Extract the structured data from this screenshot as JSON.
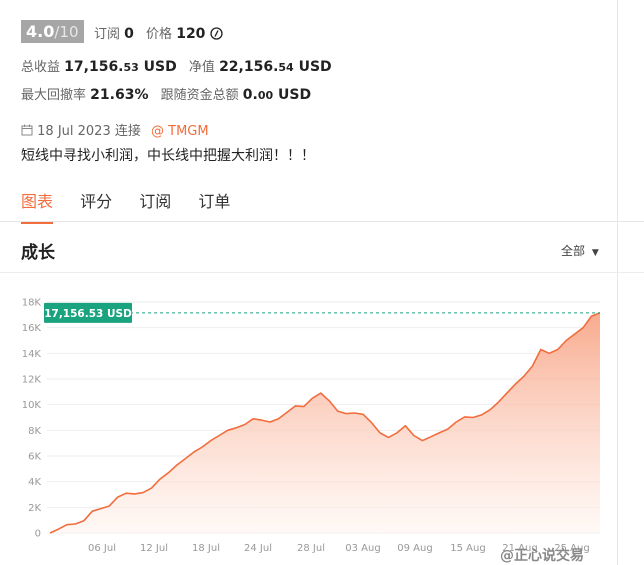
{
  "header": {
    "rating": "4.0",
    "rating_max": "/10",
    "subscribe_label": "订阅",
    "subscribe_count": "0",
    "price_label": "价格",
    "price_value": "120",
    "price_icon": "currency-coin-icon"
  },
  "stats": {
    "total_profit_label": "总收益",
    "total_profit_main": "17,156.",
    "total_profit_dec": "53",
    "total_profit_unit": " USD",
    "net_label": "净值",
    "net_main": "22,156.",
    "net_dec": "54",
    "net_unit": " USD",
    "drawdown_label": "最大回撤率",
    "drawdown_value": "21.63%",
    "follow_label": "跟随资金总额",
    "follow_main": "0.",
    "follow_dec": "00",
    "follow_unit": " USD"
  },
  "meta": {
    "date": "18 Jul 2023 连接",
    "broker": "@ TMGM",
    "description": "短线中寻找小利润，中长线中把握大利润！！！"
  },
  "tabs": [
    {
      "label": "图表",
      "active": true
    },
    {
      "label": "评分",
      "active": false
    },
    {
      "label": "订阅",
      "active": false
    },
    {
      "label": "订单",
      "active": false
    }
  ],
  "section": {
    "title": "成长",
    "range": "全部"
  },
  "watermark": "@正心说交易",
  "chart_data": {
    "type": "area",
    "y_ticks": [
      "0",
      "2K",
      "4K",
      "6K",
      "8K",
      "10K",
      "12K",
      "14K",
      "16K",
      "18K"
    ],
    "x_ticks": [
      "06 Jul",
      "12 Jul",
      "18 Jul",
      "24 Jul",
      "28 Jul",
      "03 Aug",
      "09 Aug",
      "15 Aug",
      "21 Aug",
      "25 Aug"
    ],
    "ylim": [
      0,
      18000
    ],
    "current_label": "17,156.53 USD",
    "current_value": 17156.53,
    "grid": true,
    "colors": {
      "line": "#f26d3d",
      "fill_top": "#f8a688",
      "fill_bottom": "#fff4ef",
      "label_bg": "#1aa37f",
      "dash": "#1aa37f"
    },
    "series": [
      {
        "values": [
          0,
          300,
          650,
          700,
          950,
          1700,
          1900,
          2100,
          2800,
          3100,
          3050,
          3150,
          3500,
          4200,
          4700,
          5300,
          5800,
          6300,
          6700,
          7200,
          7600,
          8000,
          8200,
          8450,
          8900,
          8800,
          8650,
          8900,
          9400,
          9900,
          9850,
          10500,
          10900,
          10300,
          9500,
          9300,
          9350,
          9250,
          8600,
          7800,
          7450,
          7800,
          8350,
          7600,
          7200,
          7500,
          7800,
          8100,
          8650,
          9050,
          9000,
          9200,
          9600,
          10200,
          10900,
          11600,
          12200,
          13000,
          14300,
          14000,
          14300,
          15000,
          15500,
          16000,
          16900,
          17156
        ]
      }
    ]
  }
}
